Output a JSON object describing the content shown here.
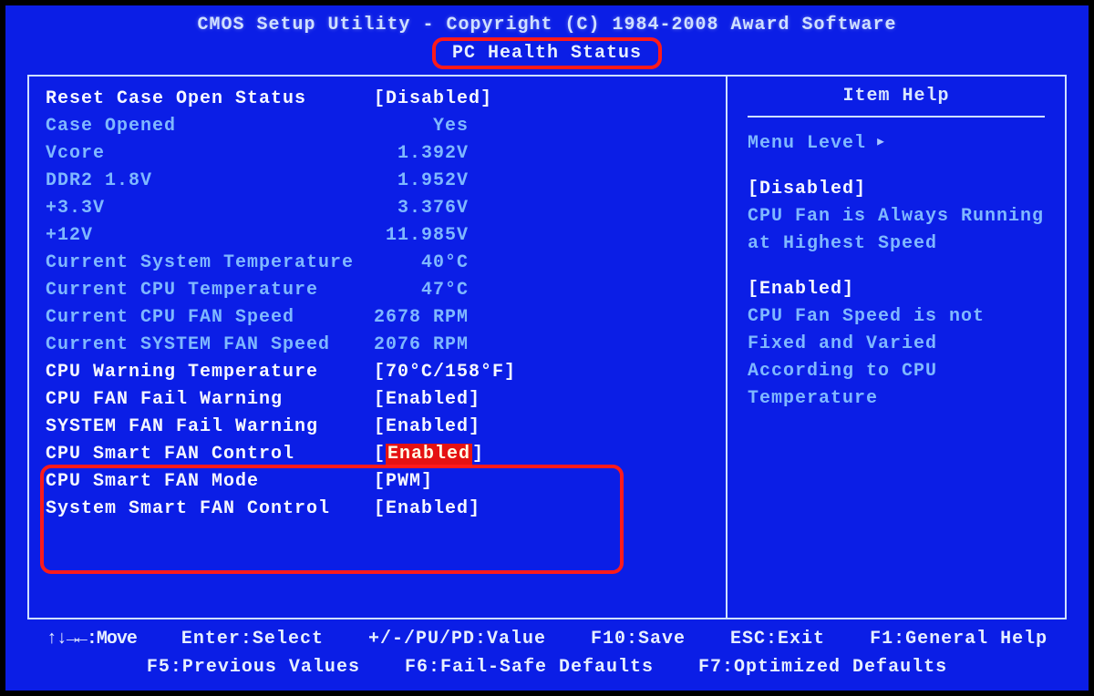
{
  "header": {
    "title": "CMOS Setup Utility - Copyright (C) 1984-2008 Award Software",
    "subtitle": "PC Health Status"
  },
  "rows": [
    {
      "label": "Reset Case Open Status",
      "value": "Disabled",
      "type": "selectable",
      "bracket": true
    },
    {
      "label": "Case Opened",
      "value": "Yes",
      "type": "info",
      "bracket": false
    },
    {
      "label": "Vcore",
      "value": "1.392V",
      "type": "info",
      "bracket": false
    },
    {
      "label": "DDR2 1.8V",
      "value": "1.952V",
      "type": "info",
      "bracket": false
    },
    {
      "label": "+3.3V",
      "value": "3.376V",
      "type": "info",
      "bracket": false
    },
    {
      "label": "+12V",
      "value": "11.985V",
      "type": "info",
      "bracket": false
    },
    {
      "label": "Current System Temperature",
      "value": "40°C",
      "type": "info",
      "bracket": false
    },
    {
      "label": "Current CPU Temperature",
      "value": "47°C",
      "type": "info",
      "bracket": false
    },
    {
      "label": "Current CPU FAN Speed",
      "value": "2678 RPM",
      "type": "info",
      "bracket": false
    },
    {
      "label": "Current SYSTEM FAN Speed",
      "value": "2076 RPM",
      "type": "info",
      "bracket": false
    },
    {
      "label": "CPU Warning Temperature",
      "value": "70°C/158°F",
      "type": "selectable",
      "bracket": true
    },
    {
      "label": "CPU FAN Fail Warning",
      "value": "Enabled",
      "type": "selectable",
      "bracket": true
    },
    {
      "label": "SYSTEM FAN Fail Warning",
      "value": "Enabled",
      "type": "selectable",
      "bracket": true
    },
    {
      "label": "CPU Smart FAN Control",
      "value": "Enabled",
      "type": "selectable",
      "bracket": true,
      "highlight": true
    },
    {
      "label": "CPU Smart FAN Mode",
      "value": "PWM",
      "type": "selectable",
      "bracket": true
    },
    {
      "label": "System Smart FAN Control",
      "value": "Enabled",
      "type": "selectable",
      "bracket": true
    }
  ],
  "help": {
    "title": "Item Help",
    "menu_level": "Menu Level",
    "sections": [
      {
        "key": "[Disabled]",
        "text": "CPU Fan is Always Running at Highest Speed"
      },
      {
        "key": "[Enabled]",
        "text": "CPU Fan Speed is not Fixed and Varied According to CPU Temperature"
      }
    ]
  },
  "footer": {
    "line1": {
      "move": "↑↓→←:Move",
      "enter": "Enter:Select",
      "pupd": "+/-/PU/PD:Value",
      "f10": "F10:Save",
      "esc": "ESC:Exit",
      "f1": "F1:General Help"
    },
    "line2": {
      "f5": "F5:Previous Values",
      "f6": "F6:Fail-Safe Defaults",
      "f7": "F7:Optimized Defaults"
    }
  }
}
